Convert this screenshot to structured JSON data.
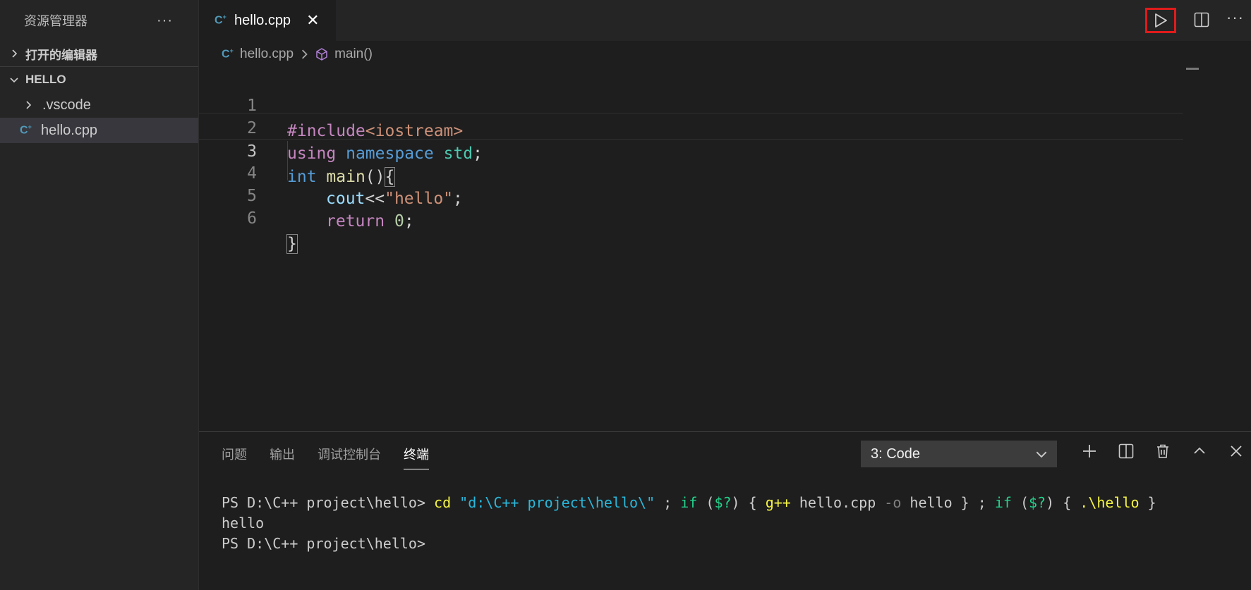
{
  "sidebar": {
    "title": "资源管理器",
    "more": "···",
    "open_editors": "打开的编辑器",
    "folder": "HELLO",
    "items": [
      {
        "label": ".vscode"
      },
      {
        "label": "hello.cpp"
      }
    ]
  },
  "tab": {
    "label": "hello.cpp",
    "close": "✕"
  },
  "breadcrumb": {
    "file": "hello.cpp",
    "symbol": "main()"
  },
  "editor": {
    "line_numbers": [
      "1",
      "2",
      "3",
      "4",
      "5",
      "6"
    ],
    "lines": {
      "l1": "#include<iostream>",
      "l2a": "using",
      "l2b": "namespace",
      "l2c": "std",
      "l2d": ";",
      "l3a": "int",
      "l3b": "main",
      "l3c": "()",
      "l3d": "{",
      "l4a": "cout",
      "l4b": "<<",
      "l4c": "\"hello\"",
      "l4d": ";",
      "l5a": "return",
      "l5b": "0",
      "l5c": ";",
      "l6": "}"
    }
  },
  "panel": {
    "tabs": [
      "问题",
      "输出",
      "调试控制台",
      "终端"
    ],
    "terminal_select": "3: Code",
    "terminal": {
      "prompt": "PS D:\\C++ project\\hello> ",
      "cmd_cd": "cd",
      "cmd_path": "\"d:\\C++ project\\hello\\\"",
      "t1": " ; ",
      "if1": "if",
      "t2": " (",
      "var1": "$?",
      "t3": ") { ",
      "gpp": "g++",
      "t4": " hello.cpp ",
      "flag": "-o",
      "t5": " hello } ; ",
      "if2": "if",
      "t6": " (",
      "var2": "$?",
      "t7": ") { ",
      "exe": ".\\hello",
      "t8": " }",
      "output": "hello",
      "prompt2": "PS D:\\C++ project\\hello>"
    }
  },
  "colors": {
    "accent_red": "#e01b1b",
    "cpp_icon": "#519aba"
  }
}
